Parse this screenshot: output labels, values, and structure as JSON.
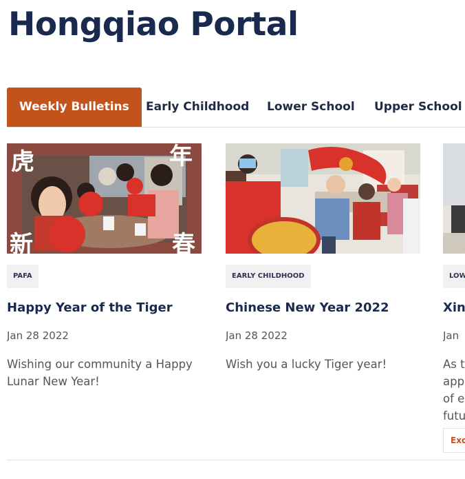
{
  "header": {
    "title": "Hongqiao Portal"
  },
  "tabs": [
    {
      "label": "Weekly Bulletins",
      "active": true
    },
    {
      "label": "Early Childhood",
      "active": false
    },
    {
      "label": "Lower School",
      "active": false
    },
    {
      "label": "Upper School",
      "active": false
    }
  ],
  "cards": [
    {
      "badge": "PAFA",
      "title": "Happy Year of the Tiger",
      "date": "Jan 28 2022",
      "description": "Wishing our community a Happy Lunar New Year!",
      "image_glyphs": [
        "虎",
        "年",
        "新",
        "春"
      ]
    },
    {
      "badge": "EARLY CHILDHOOD",
      "title": "Chinese New Year 2022",
      "date": "Jan 28 2022",
      "description": "Wish you a lucky Tiger year!"
    },
    {
      "badge": "LOW",
      "title": "Xin",
      "date": "Jan",
      "description": "As t\napp\nof e\nfutu",
      "button": "Excl"
    }
  ],
  "colors": {
    "accent": "#c3531c",
    "title": "#1a2a4f",
    "tab_text": "#1f2a44",
    "muted": "#555555"
  }
}
